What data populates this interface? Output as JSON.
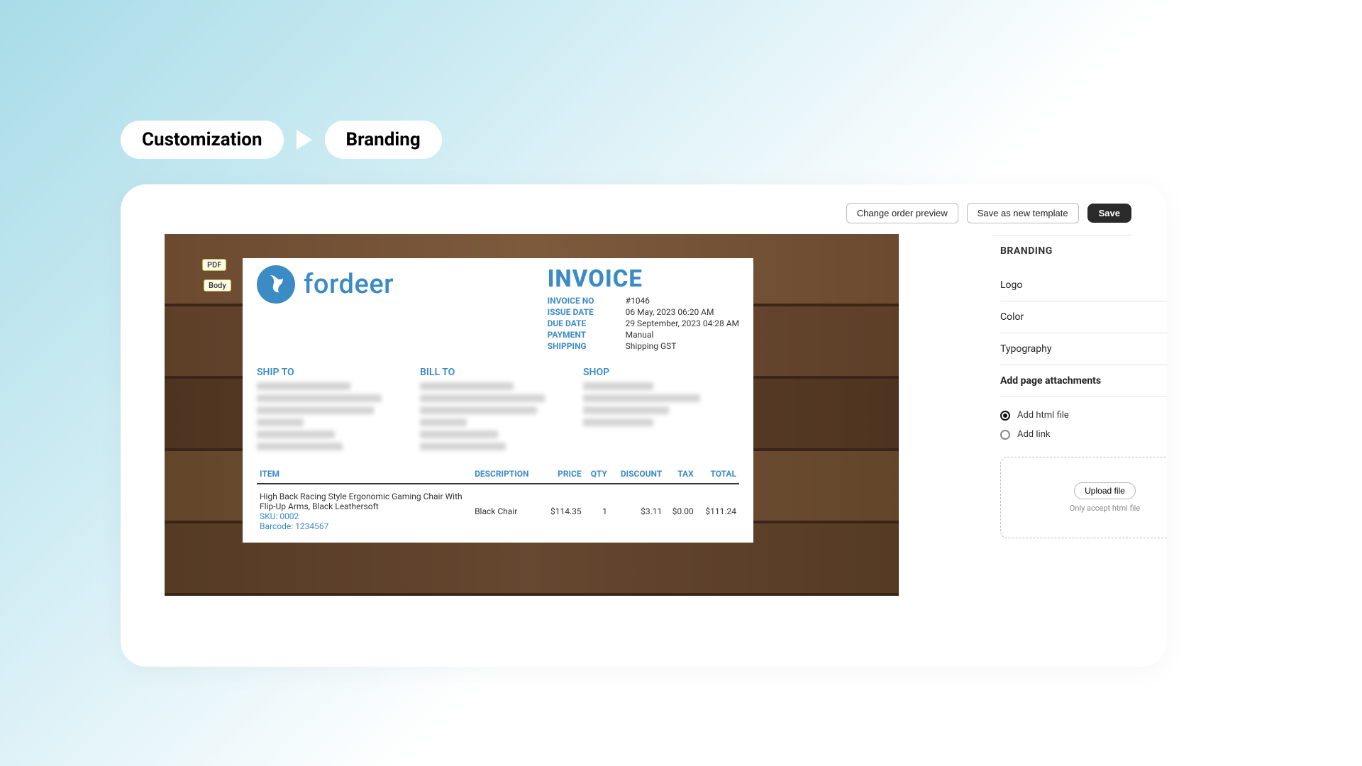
{
  "breadcrumb": {
    "step1": "Customization",
    "step2": "Branding"
  },
  "topbar": {
    "change_order": "Change order preview",
    "save_as_template": "Save as new template",
    "save": "Save"
  },
  "panel": {
    "title": "BRANDING",
    "logo": "Logo",
    "color": "Color",
    "typography": "Typography",
    "attachments": "Add page attachments",
    "add_html": "Add html file",
    "add_link": "Add link",
    "upload": "Upload file",
    "hint": "Only accept html file"
  },
  "preview": {
    "tag_pdf": "PDF",
    "tag_body": "Body",
    "brand_name": "fordeer",
    "invoice_title": "INVOICE",
    "meta": {
      "invoice_no_lbl": "INVOICE NO",
      "invoice_no_val": "#1046",
      "issue_lbl": "ISSUE DATE",
      "issue_val": "06 May, 2023 06:20 AM",
      "due_lbl": "DUE DATE",
      "due_val": "29 September, 2023 04:28 AM",
      "payment_lbl": "PAYMENT",
      "payment_val": "Manual",
      "shipping_lbl": "SHIPPING",
      "shipping_val": "Shipping GST"
    },
    "ship_to": "SHIP TO",
    "bill_to": "BILL TO",
    "shop": "SHOP",
    "table": {
      "headers": {
        "item": "ITEM",
        "desc": "DESCRIPTION",
        "price": "PRICE",
        "qty": "QTY",
        "disc": "DISCOUNT",
        "tax": "TAX",
        "total": "TOTAL"
      },
      "row": {
        "name": "High Back Racing Style Ergonomic Gaming Chair With Flip-Up Arms, Black Leathersoft",
        "sku": "SKU: 0002",
        "barcode": "Barcode: 1234567",
        "desc": "Black Chair",
        "price": "$114.35",
        "qty": "1",
        "discount": "$3.11",
        "tax": "$0.00",
        "total": "$111.24"
      }
    }
  },
  "colors": {
    "accent": "#3b8bc4"
  }
}
